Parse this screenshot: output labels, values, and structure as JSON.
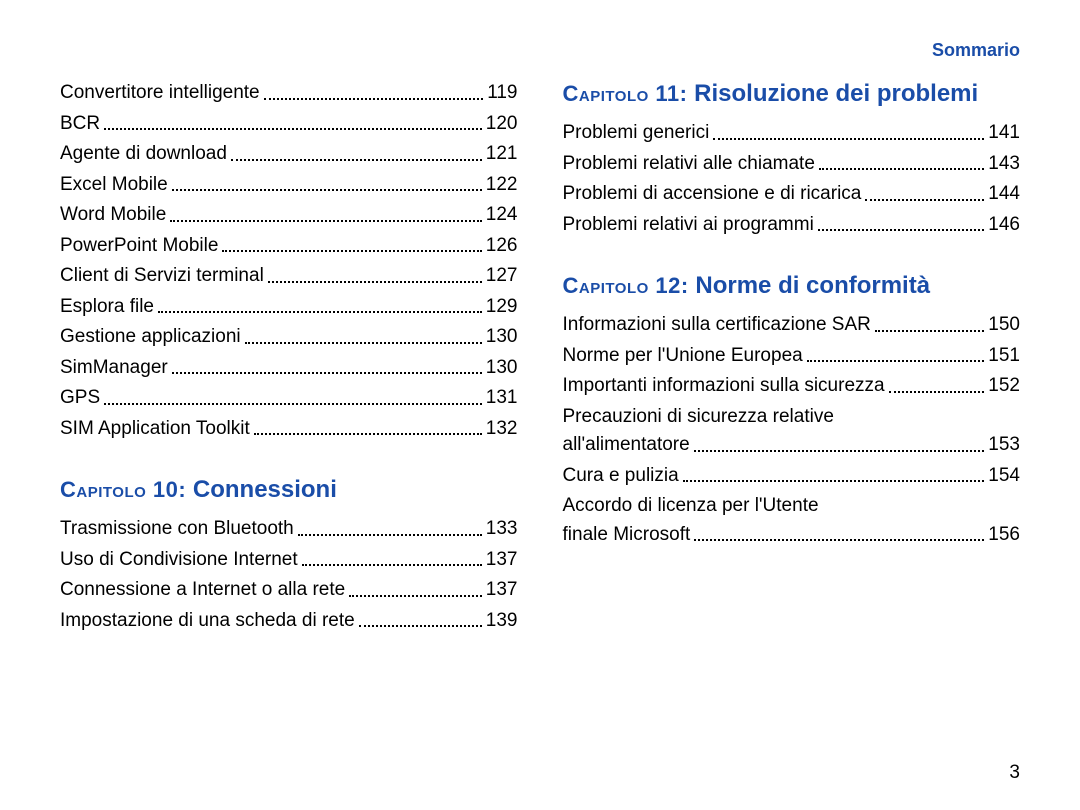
{
  "header": {
    "title": "Sommario"
  },
  "page_number": "3",
  "col_left": {
    "section_a": {
      "entries": [
        {
          "label": "Convertitore intelligente",
          "page": "119"
        },
        {
          "label": "BCR",
          "page": "120"
        },
        {
          "label": "Agente di download",
          "page": "121"
        },
        {
          "label": "Excel Mobile",
          "page": "122"
        },
        {
          "label": "Word Mobile",
          "page": "124"
        },
        {
          "label": "PowerPoint Mobile",
          "page": "126"
        },
        {
          "label": "Client di Servizi terminal",
          "page": "127"
        },
        {
          "label": "Esplora file",
          "page": "129"
        },
        {
          "label": "Gestione applicazioni",
          "page": "130"
        },
        {
          "label": "SimManager",
          "page": "130"
        },
        {
          "label": "GPS",
          "page": "131"
        },
        {
          "label": "SIM Application Toolkit",
          "page": "132"
        }
      ]
    },
    "chapter10": {
      "cap": "Capitolo 10:",
      "title": "Connessioni",
      "entries": [
        {
          "label": "Trasmissione con Bluetooth",
          "page": "133"
        },
        {
          "label": "Uso di Condivisione Internet",
          "page": "137"
        },
        {
          "label": "Connessione a Internet o alla rete",
          "page": "137"
        },
        {
          "label": "Impostazione di una scheda di rete",
          "page": "139"
        }
      ]
    }
  },
  "col_right": {
    "chapter11": {
      "cap": "Capitolo 11:",
      "title": "Risoluzione dei problemi",
      "entries": [
        {
          "label": "Problemi generici",
          "page": "141"
        },
        {
          "label": "Problemi relativi alle chiamate",
          "page": "143"
        },
        {
          "label": "Problemi di accensione e di ricarica",
          "page": "144"
        },
        {
          "label": "Problemi relativi ai programmi",
          "page": "146"
        }
      ]
    },
    "chapter12": {
      "cap": "Capitolo 12:",
      "title": "Norme di conformità",
      "entries": [
        {
          "label": "Informazioni sulla certificazione SAR",
          "page": "150"
        },
        {
          "label": "Norme per l'Unione Europea",
          "page": "151"
        },
        {
          "label": "Importanti informazioni sulla sicurezza",
          "page": "152"
        },
        {
          "label_line1": "Precauzioni di sicurezza relative",
          "label_line2": "all'alimentatore",
          "page": "153",
          "multiline": true
        },
        {
          "label": "Cura e pulizia",
          "page": "154"
        },
        {
          "label_line1": "Accordo di licenza per l'Utente",
          "label_line2": "finale Microsoft",
          "page": "156",
          "multiline": true
        }
      ]
    }
  }
}
